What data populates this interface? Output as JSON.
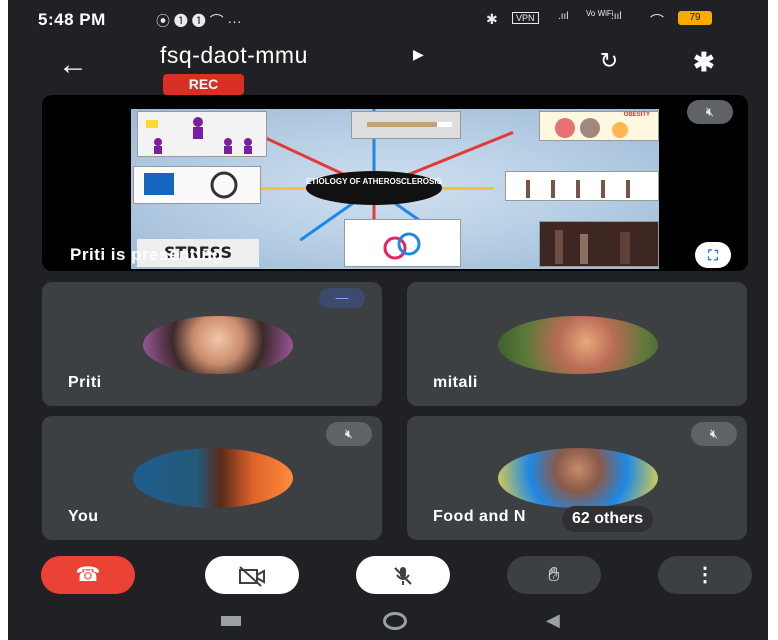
{
  "status_bar": {
    "time": "5:48 PM",
    "left_icons": "⦿ ❶ ❶ ⌒ ···",
    "vpn_label": "VPN",
    "wifi_label": "Vo WiFi",
    "battery_label": "79"
  },
  "header": {
    "meeting_title": "fsq-daot-mmu",
    "rec_label": "REC"
  },
  "presentation": {
    "presenting_label": "Priti is presenting",
    "slide_center_text": "ETIOLOGY OF ATHEROSCLEROSIS",
    "slide_stress_text": "STRESS",
    "slide_obesity_text": "OBESITY"
  },
  "participants": [
    {
      "name": "Priti"
    },
    {
      "name": "mitali"
    },
    {
      "name": "You"
    },
    {
      "name": "Food and N",
      "others_label": "62 others"
    }
  ],
  "controls": {
    "end_call_icon": "phone-hangup-icon",
    "camera_icon": "camera-off-icon",
    "mic_icon": "mic-off-icon",
    "hand_icon": "raise-hand-icon",
    "more_icon": "more-vert-icon"
  },
  "colors": {
    "background": "#202124",
    "tile": "#3c4043",
    "end_call": "#ea4335",
    "rec": "#d93025"
  }
}
